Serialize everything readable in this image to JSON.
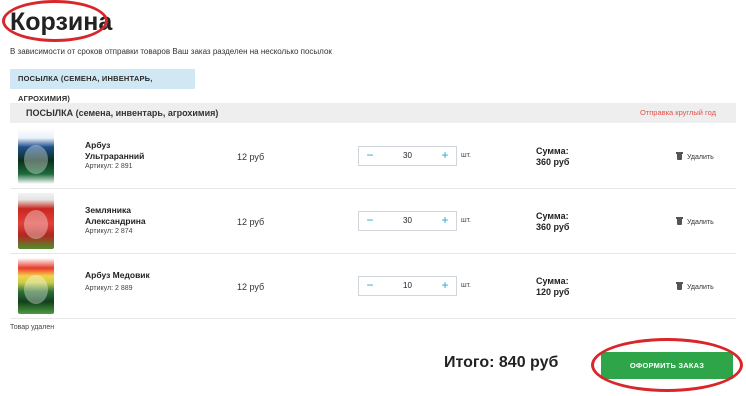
{
  "page": {
    "title": "Корзина",
    "subtitle": "В зависимости от сроков отправки товаров Ваш заказ разделен на несколько посылок"
  },
  "parcel_chip": "ПОСЫЛКА (СЕМЕНА, ИНВЕНТАРЬ, АГРОХИМИЯ)",
  "group": {
    "title": "ПОСЫЛКА (семена, инвентарь, агрохимия)",
    "shipping": "Отправка круглый год"
  },
  "items": [
    {
      "name_line1": "Арбуз",
      "name_line2": "Ультраранний",
      "sku": "Артикул: 2 891",
      "price": "12 руб",
      "minus": "−",
      "qty": "30",
      "plus": "+",
      "unit": "шт.",
      "sum_label": "Сумма:",
      "sum_value": "360 руб",
      "remove": "Удалить"
    },
    {
      "name_line1": "Земляника",
      "name_line2": "Александрина",
      "sku": "Артикул: 2 874",
      "price": "12 руб",
      "minus": "−",
      "qty": "30",
      "plus": "+",
      "unit": "шт.",
      "sum_label": "Сумма:",
      "sum_value": "360 руб",
      "remove": "Удалить"
    },
    {
      "name_line1": "Арбуз Медовик",
      "name_line2": "",
      "sku": "Артикул: 2 889",
      "price": "12 руб",
      "minus": "−",
      "qty": "10",
      "plus": "+",
      "unit": "шт.",
      "sum_label": "Сумма:",
      "sum_value": "120 руб",
      "remove": "Удалить"
    }
  ],
  "removed_note": "Товар удален",
  "total": "Итого: 840 руб",
  "order_button": "ОФОРМИТЬ ЗАКАЗ",
  "colors": {
    "accent_green": "#2fa54a",
    "chip_blue": "#cfe8f3",
    "highlight_red": "#d9262a",
    "shipping_red": "#e3504a",
    "stepper_blue": "#2aa1c8"
  },
  "icons": {
    "remove": "trash-icon"
  }
}
